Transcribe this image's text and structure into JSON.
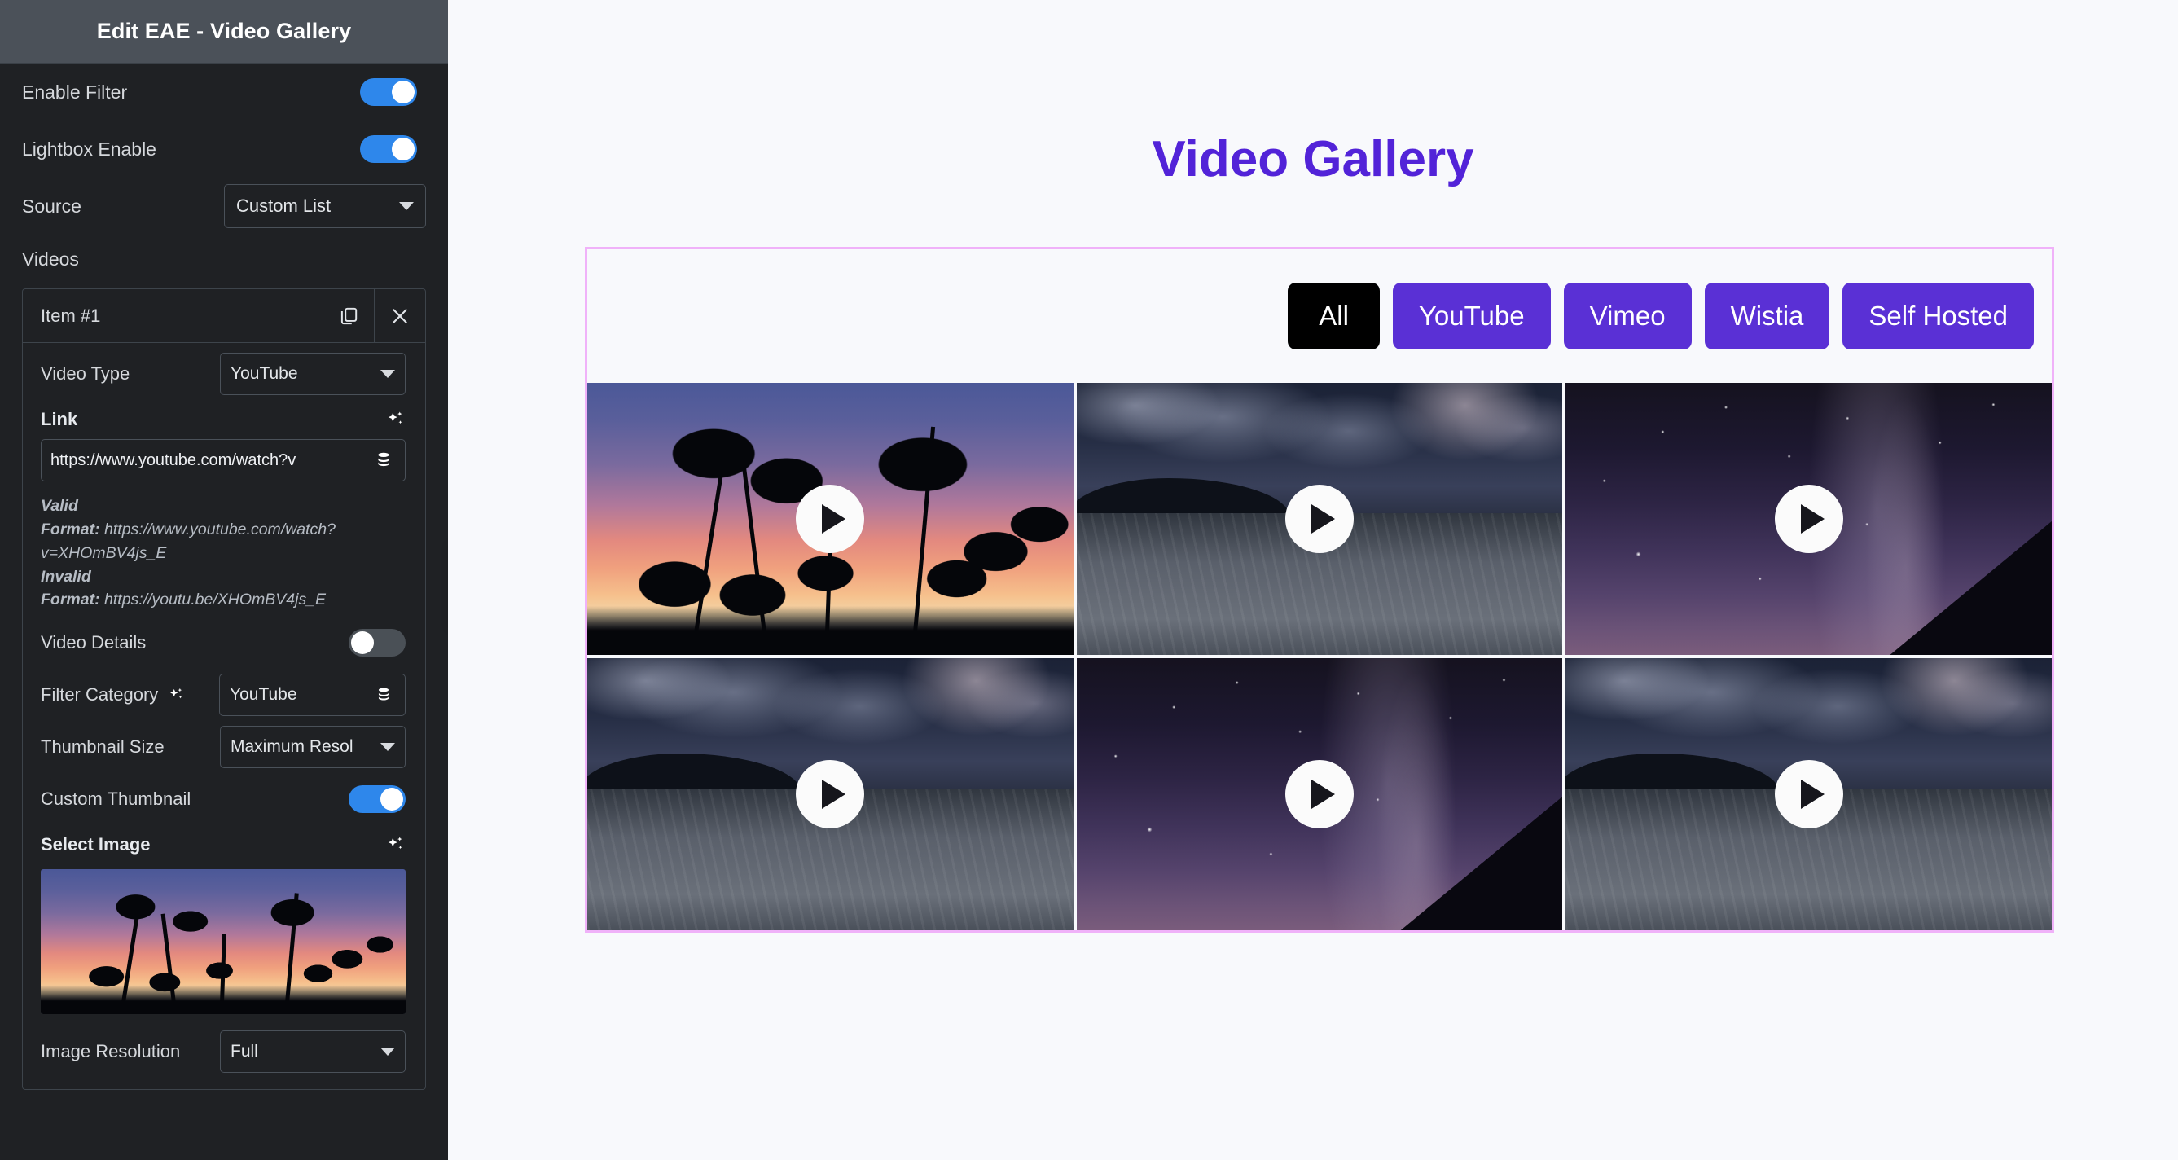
{
  "panel": {
    "title": "Edit EAE - Video Gallery",
    "enable_filter": {
      "label": "Enable Filter",
      "state": "on"
    },
    "lightbox_enable": {
      "label": "Lightbox Enable",
      "state": "on"
    },
    "source": {
      "label": "Source",
      "value": "Custom List"
    },
    "videos_label": "Videos",
    "item": {
      "title": "Item #1",
      "duplicate_icon": "copy-icon",
      "remove_icon": "close-icon",
      "video_type": {
        "label": "Video Type",
        "value": "YouTube"
      },
      "link": {
        "label": "Link",
        "ai_icon": "sparkle-icon",
        "value": "https://www.youtube.com/watch?v",
        "dynamic_icon": "database-icon"
      },
      "validation": {
        "valid_title": "Valid",
        "valid_format_label": "Format:",
        "valid_format": "https://www.youtube.com/watch?v=XHOmBV4js_E",
        "invalid_title": "Invalid",
        "invalid_format_label": "Format:",
        "invalid_format": "https://youtu.be/XHOmBV4js_E"
      },
      "video_details": {
        "label": "Video Details",
        "state": "off"
      },
      "filter_category": {
        "label": "Filter Category",
        "value": "YouTube",
        "ai_icon": "sparkle-icon",
        "dynamic_icon": "database-icon"
      },
      "thumbnail_size": {
        "label": "Thumbnail Size",
        "value": "Maximum Resol"
      },
      "custom_thumbnail": {
        "label": "Custom Thumbnail",
        "state": "on"
      },
      "select_image": {
        "label": "Select Image",
        "ai_icon": "sparkle-icon"
      },
      "image_resolution": {
        "label": "Image Resolution",
        "value": "Full"
      }
    }
  },
  "collapse_handle": {
    "icon": "chevron-left-icon"
  },
  "content": {
    "page_title": "Video Gallery",
    "filters": [
      {
        "label": "All",
        "active": true
      },
      {
        "label": "YouTube",
        "active": false
      },
      {
        "label": "Vimeo",
        "active": false
      },
      {
        "label": "Wistia",
        "active": false
      },
      {
        "label": "Self Hosted",
        "active": false
      }
    ],
    "videos": [
      {
        "art": "art-palms",
        "play_icon": "play-icon"
      },
      {
        "art": "art-night",
        "play_icon": "play-icon"
      },
      {
        "art": "art-milky",
        "play_icon": "play-icon"
      },
      {
        "art": "art-night",
        "play_icon": "play-icon"
      },
      {
        "art": "art-milky",
        "play_icon": "play-icon"
      },
      {
        "art": "art-night",
        "play_icon": "play-icon"
      }
    ]
  },
  "colors": {
    "panel_bg": "#1f2124",
    "panel_header_bg": "#4b5159",
    "toggle_on": "#2e87eb",
    "toggle_off": "#4a5056",
    "accent_purple": "#5a30d5",
    "title_purple": "#5223d8",
    "gallery_outline": "#f0b2f9",
    "active_filter_bg": "#000000",
    "content_bg": "#f8f9fc"
  }
}
